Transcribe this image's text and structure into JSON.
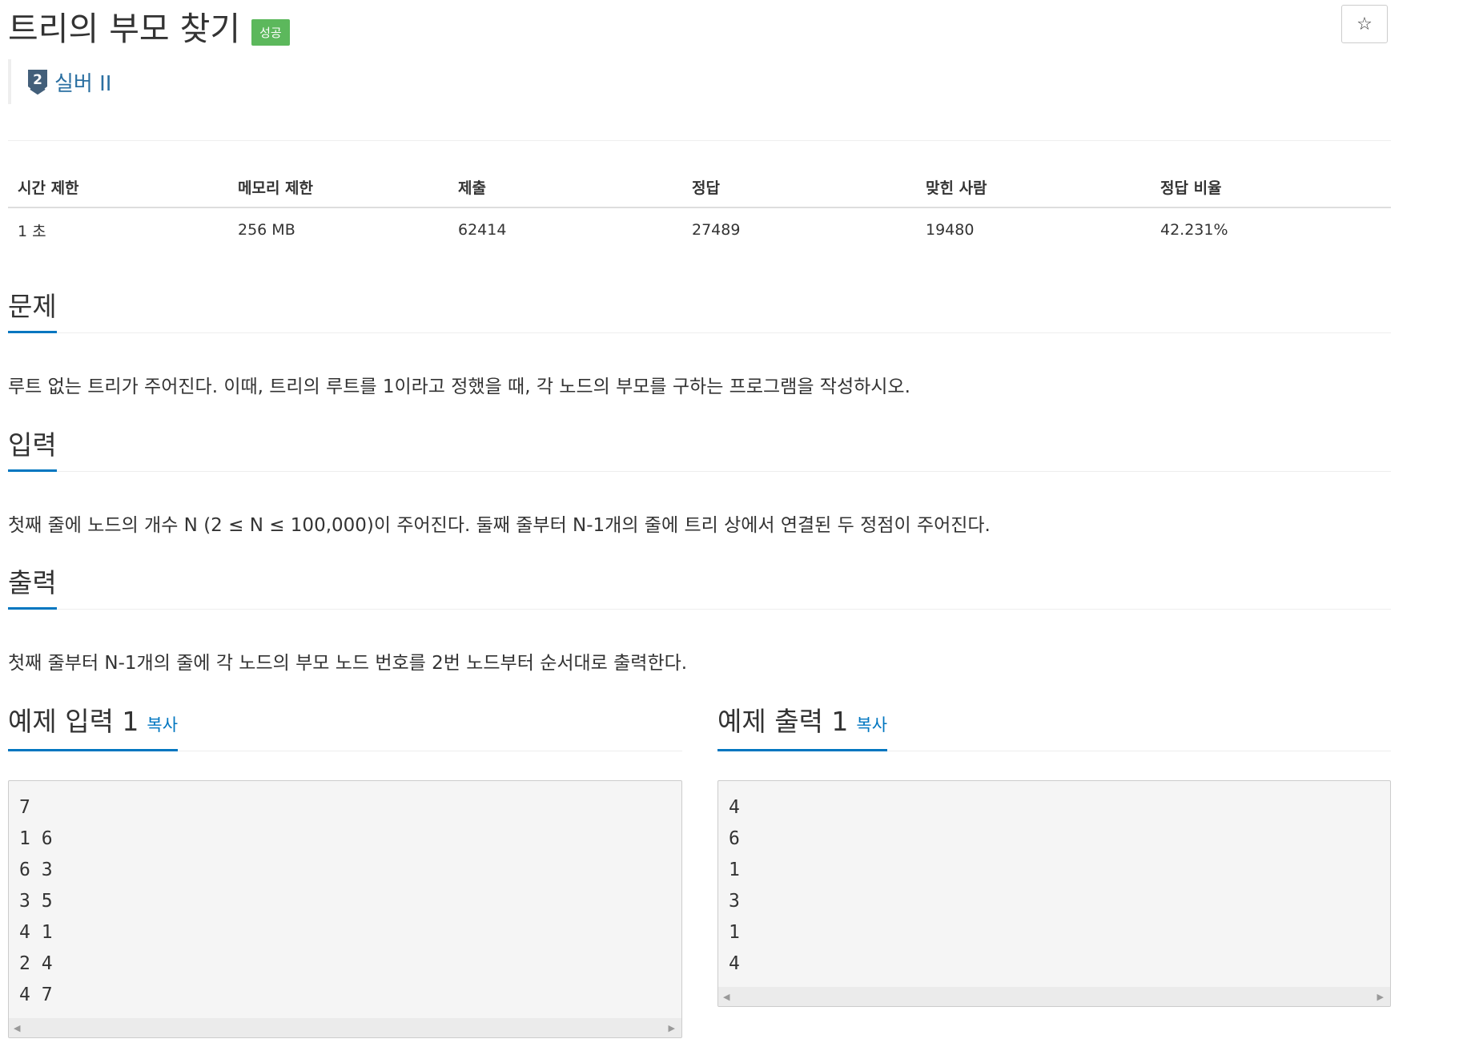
{
  "problem": {
    "title": "트리의 부모 찾기",
    "result_badge": "성공",
    "tier": "실버 II",
    "tier_icon": "shield-2-icon",
    "star_icon": "star-outline-icon",
    "colors": {
      "badge": "#5cb85c",
      "tier": "#2a6fa1",
      "accent": "#0076c0"
    }
  },
  "info": {
    "headers": [
      "시간 제한",
      "메모리 제한",
      "제출",
      "정답",
      "맞힌 사람",
      "정답 비율"
    ],
    "values": [
      "1 초",
      "256 MB",
      "62414",
      "27489",
      "19480",
      "42.231%"
    ]
  },
  "sections": {
    "description": {
      "heading": "문제",
      "text": "루트 없는 트리가 주어진다. 이때, 트리의 루트를 1이라고 정했을 때, 각 노드의 부모를 구하는 프로그램을 작성하시오."
    },
    "input": {
      "heading": "입력",
      "text": "첫째 줄에 노드의 개수 N (2 ≤ N ≤ 100,000)이 주어진다. 둘째 줄부터 N-1개의 줄에 트리 상에서 연결된 두 정점이 주어진다."
    },
    "output": {
      "heading": "출력",
      "text": "첫째 줄부터 N-1개의 줄에 각 노드의 부모 노드 번호를 2번 노드부터 순서대로 출력한다."
    }
  },
  "samples": {
    "input": {
      "heading": "예제 입력 1",
      "copy_label": "복사",
      "content": "7\n1 6\n6 3\n3 5\n4 1\n2 4\n4 7"
    },
    "output": {
      "heading": "예제 출력 1",
      "copy_label": "복사",
      "content": "4\n6\n1\n3\n1\n4"
    }
  }
}
